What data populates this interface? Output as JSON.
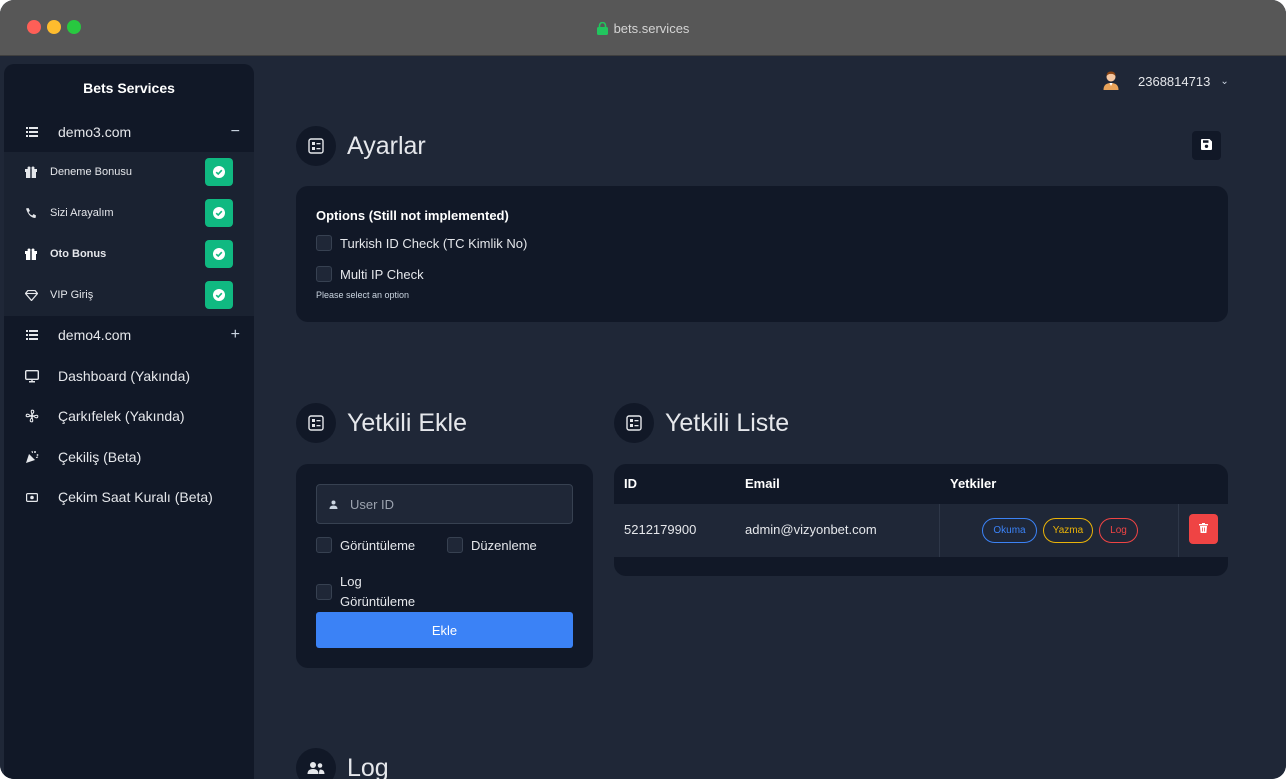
{
  "browser": {
    "url": "bets.services"
  },
  "sidebar": {
    "brand": "Bets Services",
    "groups": [
      {
        "label": "demo3.com",
        "toggle": "−",
        "icon": "list-icon"
      },
      {
        "label": "demo4.com",
        "toggle": "+",
        "icon": "list-icon"
      }
    ],
    "sub_items": [
      {
        "label": "Deneme Bonusu",
        "icon": "gift-icon",
        "enabled": true
      },
      {
        "label": "Sizi Arayalım",
        "icon": "phone-icon",
        "enabled": true
      },
      {
        "label": "Oto Bonus",
        "icon": "gift-icon",
        "enabled": true
      },
      {
        "label": "VIP Giriş",
        "icon": "diamond-icon",
        "enabled": true
      }
    ],
    "items": [
      {
        "label": "Dashboard (Yakında)",
        "icon": "monitor-icon"
      },
      {
        "label": "Çarkıfelek (Yakında)",
        "icon": "fan-icon"
      },
      {
        "label": "Çekiliş (Beta)",
        "icon": "party-icon"
      },
      {
        "label": "Çekim Saat Kuralı (Beta)",
        "icon": "money-icon"
      }
    ]
  },
  "header": {
    "user_id": "2368814713"
  },
  "settings": {
    "title": "Ayarlar",
    "options_title": "Options (Still not implemented)",
    "options": [
      "Turkish ID Check (TC Kimlik No)",
      "Multi IP Check"
    ],
    "hint": "Please select an option"
  },
  "add_admin": {
    "title": "Yetkili Ekle",
    "user_placeholder": "User ID",
    "perm_view": "Görüntüleme",
    "perm_edit": "Düzenleme",
    "perm_log_1": "Log",
    "perm_log_2": "Görüntüleme",
    "submit": "Ekle"
  },
  "admin_list": {
    "title": "Yetkili Liste",
    "columns": [
      "ID",
      "Email",
      "Yetkiler"
    ],
    "rows": [
      {
        "id": "5212179900",
        "email": "admin@vizyonbet.com",
        "perms": [
          "Okuma",
          "Yazma",
          "Log"
        ]
      }
    ]
  },
  "log": {
    "title": "Log"
  },
  "colors": {
    "accent": "#3b82f6",
    "success": "#10b981",
    "danger": "#ef4444",
    "warning": "#eab308",
    "background": "#1f2737",
    "panel": "#111827"
  }
}
